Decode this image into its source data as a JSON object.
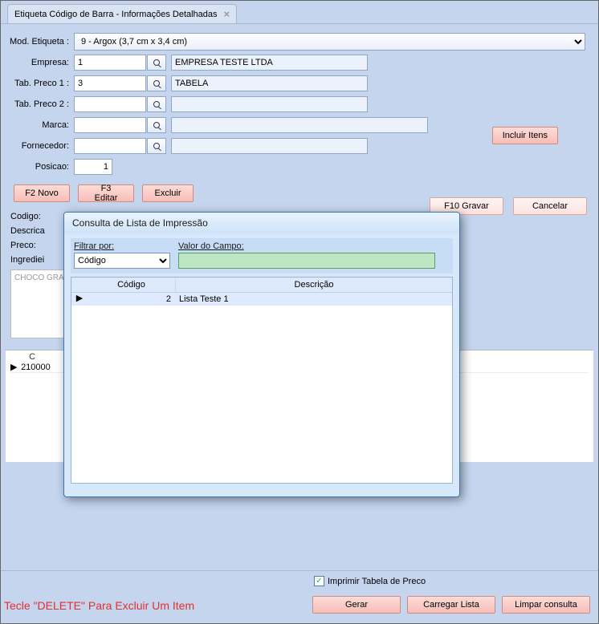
{
  "tab": {
    "title": "Etiqueta Código de Barra - Informações Detalhadas"
  },
  "fields": {
    "mod_etiqueta_label": "Mod. Etiqueta :",
    "mod_etiqueta_value": "9 - Argox (3,7 cm x 3,4 cm)",
    "empresa_label": "Empresa:",
    "empresa_value": "1",
    "empresa_desc": "EMPRESA TESTE LTDA",
    "tab_preco1_label": "Tab. Preco 1 :",
    "tab_preco1_value": "3",
    "tab_preco1_desc": "TABELA",
    "tab_preco2_label": "Tab. Preco 2 :",
    "tab_preco2_value": "",
    "tab_preco2_desc": "",
    "marca_label": "Marca:",
    "marca_value": "",
    "marca_desc": "",
    "fornecedor_label": "Fornecedor:",
    "fornecedor_value": "",
    "fornecedor_desc": "",
    "posicao_label": "Posicao:",
    "posicao_value": "1"
  },
  "buttons": {
    "incluir_itens": "Incluir Itens",
    "f2_novo": "F2 Novo",
    "f3_editar": "F3 Editar",
    "excluir": "Excluir",
    "f10_gravar": "F10 Gravar",
    "cancelar": "Cancelar"
  },
  "detail": {
    "codigo_label": "Codigo:",
    "descricao_label": "Descrica",
    "preco_label": "Preco:",
    "ingredientes_label": "Ingrediei",
    "ingredientes_text": "CHOCO\nGRANUL\nLEITE C"
  },
  "grid": {
    "col_code_hdr": "C",
    "row1_code": "210000"
  },
  "footer": {
    "hint": "Tecle \"DELETE\" Para Excluir Um Item",
    "imprimir_label": "Imprimir Tabela de Preco",
    "imprimir_checked": true,
    "gerar": "Gerar",
    "carregar_lista": "Carregar Lista",
    "limpar_consulta": "Limpar consulta"
  },
  "modal": {
    "title": "Consulta de Lista de Impressão",
    "filtrar_por_label": "Filtrar por:",
    "filtrar_por_value": "Código",
    "valor_campo_label": "Valor do Campo:",
    "valor_campo_value": "",
    "col_codigo": "Código",
    "col_descricao": "Descrição",
    "rows": [
      {
        "codigo": "2",
        "descricao": "Lista Teste 1"
      }
    ]
  }
}
